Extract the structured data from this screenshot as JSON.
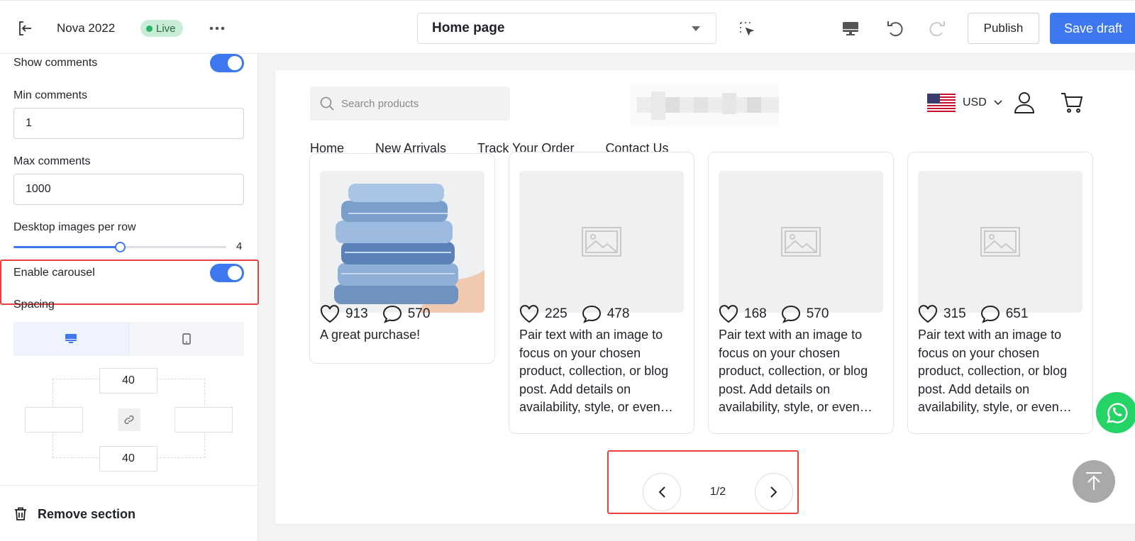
{
  "header": {
    "store_name": "Nova 2022",
    "status_badge": "Live",
    "page_selector": "Home page",
    "publish_label": "Publish",
    "save_draft_label": "Save draft"
  },
  "sidebar": {
    "show_comments_label": "Show comments",
    "show_comments_on": true,
    "min_comments_label": "Min comments",
    "min_comments_value": "1",
    "max_comments_label": "Max comments",
    "max_comments_value": "1000",
    "images_per_row_label": "Desktop images per row",
    "images_per_row_value": "4",
    "images_per_row_fraction": 0.5,
    "enable_carousel_label": "Enable carousel",
    "enable_carousel_on": true,
    "spacing_label": "Spacing",
    "spacing_top": "40",
    "spacing_bottom": "40",
    "spacing_left": "",
    "spacing_right": "",
    "remove_section_label": "Remove section"
  },
  "preview": {
    "search_placeholder": "Search products",
    "currency": "USD",
    "nav": [
      "Home",
      "New Arrivals",
      "Track Your Order",
      "Contact Us"
    ],
    "cards": [
      {
        "likes": "913",
        "comments": "570",
        "caption": "A great purchase!",
        "image": "denim-stack"
      },
      {
        "likes": "225",
        "comments": "478",
        "caption": "Pair text with an image to focus on your chosen product, collection, or blog post. Add details on availability, style, or even…",
        "image": "placeholder"
      },
      {
        "likes": "168",
        "comments": "570",
        "caption": "Pair text with an image to focus on your chosen product, collection, or blog post. Add details on availability, style, or even…",
        "image": "placeholder"
      },
      {
        "likes": "315",
        "comments": "651",
        "caption": "Pair text with an image to focus on your chosen product, collection, or blog post. Add details on availability, style, or even…",
        "image": "placeholder"
      }
    ],
    "pager_text": "1/2"
  },
  "colors": {
    "accent": "#3e78f0",
    "highlight": "#e9413f",
    "live_bg": "#c9ecd6",
    "whatsapp": "#25d366"
  }
}
